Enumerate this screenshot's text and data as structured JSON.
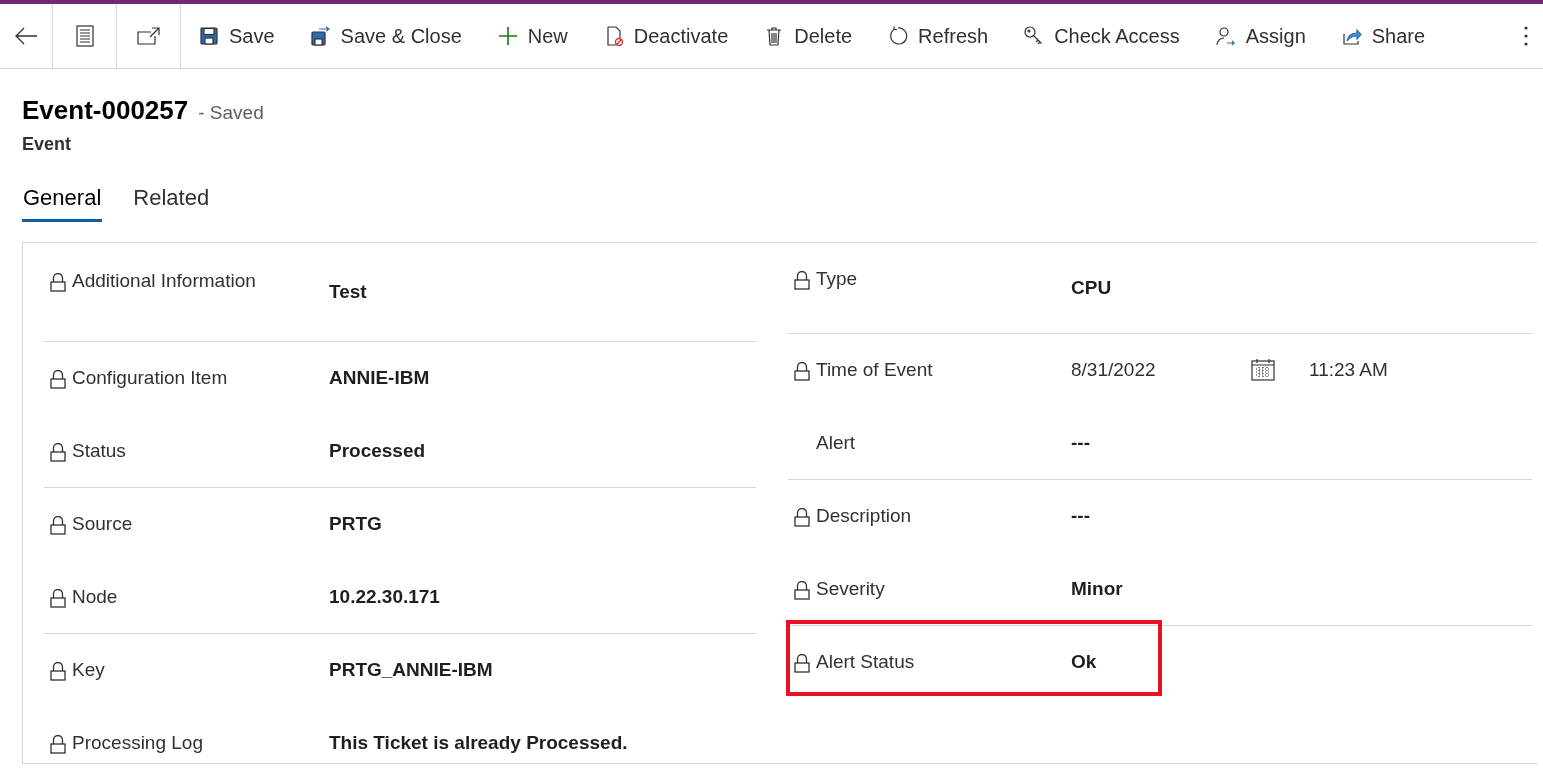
{
  "toolbar": {
    "buttons": [
      {
        "label": "Save"
      },
      {
        "label": "Save & Close"
      },
      {
        "label": "New"
      },
      {
        "label": "Deactivate"
      },
      {
        "label": "Delete"
      },
      {
        "label": "Refresh"
      },
      {
        "label": "Check Access"
      },
      {
        "label": "Assign"
      },
      {
        "label": "Share"
      }
    ]
  },
  "header": {
    "title": "Event-000257",
    "save_status": "- Saved",
    "entity": "Event"
  },
  "tabs": [
    {
      "label": "General",
      "selected": true
    },
    {
      "label": "Related",
      "selected": false
    }
  ],
  "columns": [
    {
      "fields": [
        {
          "label": "Additional Information",
          "value": "Test",
          "locked": true,
          "kind": "text",
          "divider_below": true,
          "highlighted": false
        },
        {
          "label": "Configuration Item",
          "value": "ANNIE-IBM",
          "locked": true,
          "kind": "text",
          "divider_below": false,
          "highlighted": false
        },
        {
          "label": "Status",
          "value": "Processed",
          "locked": true,
          "kind": "text",
          "divider_below": true,
          "highlighted": false
        },
        {
          "label": "Source",
          "value": "PRTG",
          "locked": true,
          "kind": "text",
          "divider_below": false,
          "highlighted": false
        },
        {
          "label": "Node",
          "value": "10.22.30.171",
          "locked": true,
          "kind": "text",
          "divider_below": true,
          "highlighted": false
        },
        {
          "label": "Key",
          "value": "PRTG_ANNIE-IBM",
          "locked": true,
          "kind": "text",
          "divider_below": false,
          "highlighted": false
        },
        {
          "label": "Processing Log",
          "value": "This Ticket is already  Processed.",
          "locked": true,
          "kind": "text",
          "divider_below": false,
          "highlighted": false
        }
      ]
    },
    {
      "fields": [
        {
          "label": "Type",
          "value": "CPU",
          "locked": true,
          "kind": "text",
          "divider_below": true,
          "highlighted": false
        },
        {
          "label": "Time of Event",
          "date": "8/31/2022",
          "time": "11:23 AM",
          "locked": true,
          "kind": "datetime",
          "divider_below": false,
          "highlighted": false
        },
        {
          "label": "Alert",
          "value": "---",
          "locked": false,
          "kind": "text",
          "divider_below": true,
          "highlighted": false
        },
        {
          "label": "Description",
          "value": "---",
          "locked": true,
          "kind": "text",
          "divider_below": false,
          "highlighted": false
        },
        {
          "label": "Severity",
          "value": "Minor",
          "locked": true,
          "kind": "text",
          "divider_below": true,
          "highlighted": false
        },
        {
          "label": "Alert Status",
          "value": "Ok",
          "locked": true,
          "kind": "text",
          "divider_below": false,
          "highlighted": true
        }
      ]
    }
  ]
}
